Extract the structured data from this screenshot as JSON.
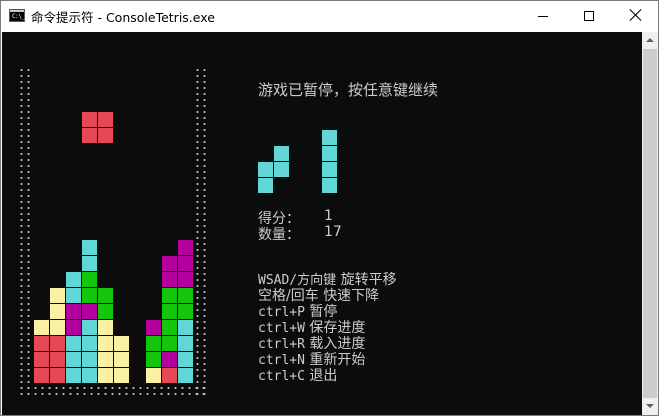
{
  "window": {
    "title": "命令提示符 - ConsoleTetris.exe",
    "app_icon_text": "C:\\_",
    "buttons": [
      "minimize",
      "maximize",
      "close"
    ]
  },
  "colors": {
    "console_bg": "#0c0c0c",
    "text": "#cccccc",
    "cyan": "#61d6d6",
    "red": "#e74856",
    "magenta": "#b4009e",
    "green": "#16c60c",
    "yellow": "#f9f1a5",
    "border_dots": "#c0c0c0"
  },
  "game": {
    "status": "游戏已暂停，按任意键继续",
    "score_label": "得分：",
    "score": "1",
    "count_label": "数量：",
    "count": "17",
    "falling_piece": "O-piece",
    "falling_piece_color": "red",
    "next_pieces": [
      "S-piece",
      "I-piece"
    ],
    "next_pieces_color": "cyan",
    "help": [
      {
        "key": "WSAD/方向键",
        "action": "旋转平移"
      },
      {
        "key": "空格/回车",
        "action": "快速下降"
      },
      {
        "key": "ctrl+P",
        "action": "暂停"
      },
      {
        "key": "ctrl+W",
        "action": "保存进度"
      },
      {
        "key": "ctrl+R",
        "action": "载入进度"
      },
      {
        "key": "ctrl+N",
        "action": "重新开始"
      },
      {
        "key": "ctrl+C",
        "action": "退出"
      }
    ]
  }
}
